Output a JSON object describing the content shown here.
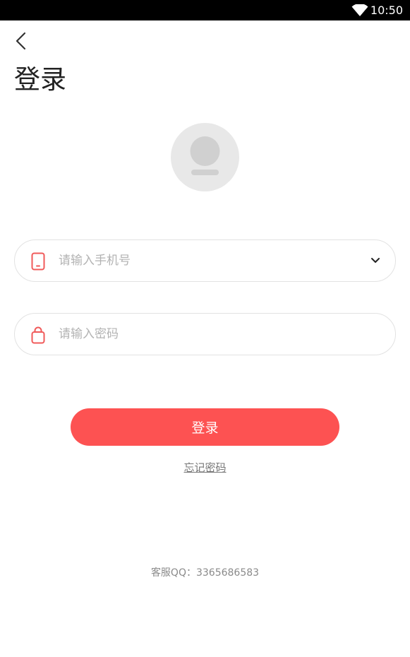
{
  "status_bar": {
    "time": "10:50",
    "wifi_icon": "wifi-icon"
  },
  "header": {
    "back_icon": "chevron-left-icon",
    "title": "登录"
  },
  "avatar": {
    "icon": "user-avatar-icon"
  },
  "form": {
    "phone": {
      "icon": "phone-icon",
      "placeholder": "请输入手机号",
      "value": "",
      "dropdown_icon": "chevron-down-icon"
    },
    "password": {
      "icon": "lock-icon",
      "placeholder": "请输入密码",
      "value": ""
    },
    "submit_label": "登录",
    "forgot_label": "忘记密码"
  },
  "footer": {
    "service_text": "客服QQ：3365686583"
  },
  "colors": {
    "accent": "#fd5252",
    "field_border": "#e2e2e2",
    "avatar_bg": "#e8e8e8",
    "placeholder": "#b3b3b3"
  }
}
